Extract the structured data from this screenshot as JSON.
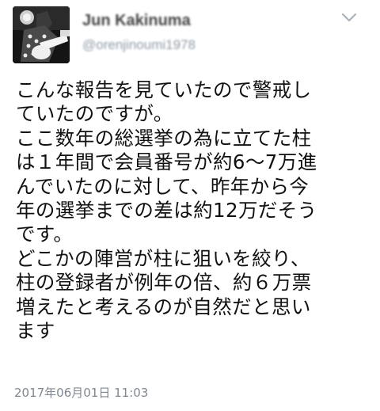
{
  "author": {
    "display_name": "Jun Kakinuma",
    "handle": "@orenjinoumi1978",
    "avatar_icon": "guitarist-photo-avatar"
  },
  "menu_icon": "chevron-down-icon",
  "tweet": {
    "lines": [
      "こんな報告を見ていたので警戒し",
      "ていたのですが。",
      "ここ数年の総選挙の為に立てた柱",
      "は１年間で会員番号が約6〜7万進",
      "んでいたのに対して、昨年から今",
      "年の選挙までの差は約12万だそう",
      "です。",
      "どこかの陣営が柱に狙いを絞り、",
      "柱の登録者が例年の倍、約６万票",
      "増えたと考えるのが自然だと思い",
      "ます"
    ],
    "timestamp": "2017年06月01日 11:03"
  },
  "colors": {
    "text": "#111111",
    "meta": "#7f8891",
    "background": "#ffffff"
  }
}
